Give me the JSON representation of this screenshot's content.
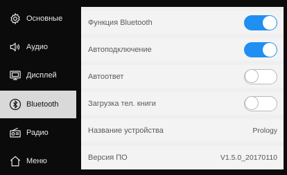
{
  "sidebar": {
    "items": [
      {
        "label": "Основные",
        "icon": "gear-icon",
        "active": false
      },
      {
        "label": "Аудио",
        "icon": "speaker-icon",
        "active": false
      },
      {
        "label": "Дисплей",
        "icon": "display-icon",
        "active": false
      },
      {
        "label": "Bluetooth",
        "icon": "bluetooth-icon",
        "active": true
      },
      {
        "label": "Радио",
        "icon": "radio-icon",
        "active": false
      },
      {
        "label": "Меню",
        "icon": "home-icon",
        "active": false
      }
    ]
  },
  "settings": {
    "rows": [
      {
        "label": "Функция Bluetooth",
        "toggle": "on"
      },
      {
        "label": "Автоподключение",
        "toggle": "on"
      },
      {
        "label": "Автоответ",
        "toggle": "off"
      },
      {
        "label": "Загрузка тел. книги",
        "toggle": "off"
      },
      {
        "label": "Название устройства",
        "value": "Prology"
      },
      {
        "label": "Версия ПО",
        "value": "V1.5.0_20170110"
      }
    ]
  },
  "colors": {
    "accent": "#1f8ff2",
    "sidebar_bg": "#0b0b0b",
    "active_bg": "#d9d9d9"
  }
}
